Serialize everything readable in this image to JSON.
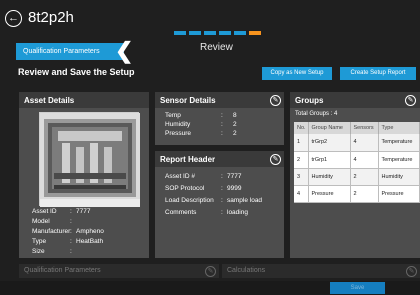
{
  "app": {
    "title": "8t2p2h"
  },
  "wizard": {
    "step_label": "Review",
    "steps_total": 6,
    "current_step": 6
  },
  "tab": {
    "label": "Qualification Parameters"
  },
  "page": {
    "title": "Review and Save the Setup"
  },
  "actions": {
    "copy_label": "Copy as New Setup",
    "create_report_label": "Create Setup Report"
  },
  "asset": {
    "header": "Asset Details",
    "fields": [
      {
        "key": "Asset ID",
        "value": "7777"
      },
      {
        "key": "Model",
        "value": ""
      },
      {
        "key": "Manufacturer",
        "value": "Ampheno"
      },
      {
        "key": "Type",
        "value": "HeatBath"
      },
      {
        "key": "Size",
        "value": ""
      }
    ]
  },
  "sensor": {
    "header": "Sensor Details",
    "fields": [
      {
        "key": "Temp",
        "value": "8"
      },
      {
        "key": "Humidity",
        "value": "2"
      },
      {
        "key": "Pressure",
        "value": "2"
      }
    ]
  },
  "report": {
    "header": "Report Header",
    "fields": [
      {
        "key": "Asset ID #",
        "value": "7777"
      },
      {
        "key": "SOP Protocol",
        "value": "9999"
      },
      {
        "key": "Load Description",
        "value": "sample load"
      },
      {
        "key": "Comments",
        "value": "loading"
      }
    ]
  },
  "groups": {
    "header": "Groups",
    "total_label": "Total Groups : 4",
    "columns": [
      "No.",
      "Group Name",
      "Sensors",
      "Type"
    ],
    "rows": [
      [
        "1",
        "trGrp2",
        "4",
        "Temperature"
      ],
      [
        "2",
        "trGrp1",
        "4",
        "Temperature"
      ],
      [
        "3",
        "Humidity",
        "2",
        "Humidity"
      ],
      [
        "4",
        "Pressure",
        "2",
        "Pressure"
      ]
    ]
  },
  "bottom": {
    "left_title": "Qualification Parameters",
    "right_title": "Calculations"
  },
  "footer": {
    "done_label": "Save"
  },
  "colors": {
    "accent": "#1e9ad6",
    "current_step": "#f7931e",
    "panel": "#4d4d4d"
  }
}
